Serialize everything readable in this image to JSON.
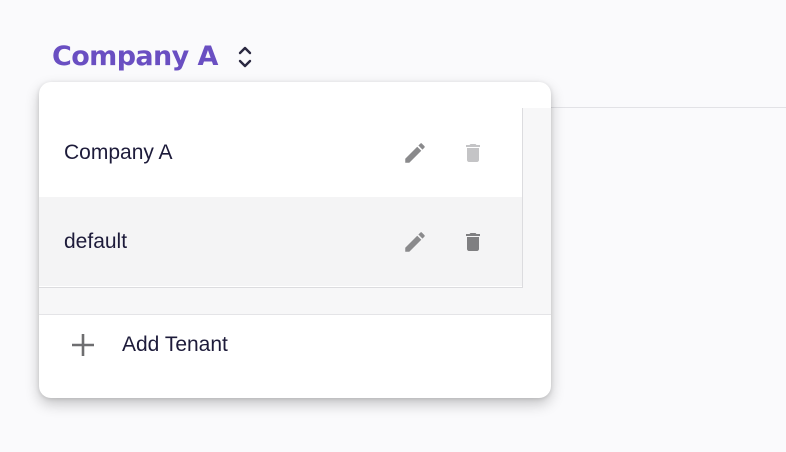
{
  "tenant_selector": {
    "current": "Company A",
    "icon": "unfold-more-icon",
    "accent_color": "#6a4fc2"
  },
  "tenant_menu": {
    "tenants": [
      {
        "name": "Company A",
        "edit_icon": "pencil-icon",
        "delete_icon": "trash-icon",
        "delete_enabled": false
      },
      {
        "name": "default",
        "edit_icon": "pencil-icon",
        "delete_icon": "trash-icon",
        "delete_enabled": true
      }
    ],
    "add_label": "Add Tenant",
    "add_icon": "plus-icon"
  }
}
